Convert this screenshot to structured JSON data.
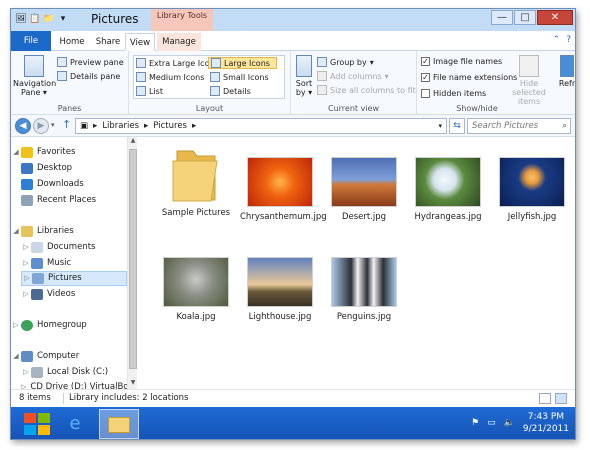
{
  "window": {
    "title": "Pictures",
    "context_tab_group": "Library Tools",
    "controls": {
      "minimize": "—",
      "maximize": "□",
      "close": "✕"
    }
  },
  "tabs": [
    {
      "label": "File"
    },
    {
      "label": "Home"
    },
    {
      "label": "Share"
    },
    {
      "label": "View"
    },
    {
      "label": "Manage"
    }
  ],
  "ribbon": {
    "panes": {
      "label": "Panes",
      "navigation_pane": "Navigation Pane",
      "preview_pane": "Preview pane",
      "details_pane": "Details pane"
    },
    "layout": {
      "label": "Layout",
      "options": [
        "Extra Large Icons",
        "Large Icons",
        "Medium Icons",
        "Small Icons",
        "List",
        "Details"
      ],
      "selected": "Large Icons"
    },
    "current_view": {
      "label": "Current view",
      "sort_by": "Sort by",
      "group_by": "Group by",
      "add_columns": "Add columns",
      "size_all_columns": "Size all columns to fit"
    },
    "show_hide": {
      "label": "Show/hide",
      "image_file_names": "Image file names",
      "file_name_extensions": "File name extensions",
      "hidden_items": "Hidden items",
      "hide_selected": "Hide selected items",
      "refresh_partial": "Refr"
    }
  },
  "address": {
    "breadcrumbs": [
      "Libraries",
      "Pictures"
    ],
    "search_placeholder": "Search Pictures"
  },
  "nav": {
    "favorites": "Favorites",
    "desktop": "Desktop",
    "downloads": "Downloads",
    "recent_places": "Recent Places",
    "libraries": "Libraries",
    "documents": "Documents",
    "music": "Music",
    "pictures": "Pictures",
    "videos": "Videos",
    "homegroup": "Homegroup",
    "computer": "Computer",
    "local_disk": "Local Disk (C:)",
    "cd_drive": "CD Drive (D:) VirtualBo"
  },
  "files": [
    {
      "name": "Sample Pictures",
      "kind": "folder"
    },
    {
      "name": "Chrysanthemum.jpg",
      "kind": "image",
      "colors": [
        "#f0640f",
        "#c0250a"
      ]
    },
    {
      "name": "Desert.jpg",
      "kind": "image",
      "colors": [
        "#5f7ec0",
        "#c05a2a"
      ]
    },
    {
      "name": "Hydrangeas.jpg",
      "kind": "image",
      "colors": [
        "#3f6a2e",
        "#e3eef4"
      ]
    },
    {
      "name": "Jellyfish.jpg",
      "kind": "image",
      "colors": [
        "#0a2a66",
        "#e89a3c"
      ]
    },
    {
      "name": "Koala.jpg",
      "kind": "image",
      "colors": [
        "#8a8e86",
        "#4f5a3a"
      ]
    },
    {
      "name": "Lighthouse.jpg",
      "kind": "image",
      "colors": [
        "#5f83c0",
        "#7a6a4a"
      ]
    },
    {
      "name": "Penguins.jpg",
      "kind": "image",
      "colors": [
        "#a8c6e6",
        "#2c3038"
      ]
    }
  ],
  "status": {
    "item_count": "8 items",
    "library_info": "Library includes: 2 locations"
  },
  "taskbar": {
    "time": "7:43 PM",
    "date": "9/21/2011"
  }
}
